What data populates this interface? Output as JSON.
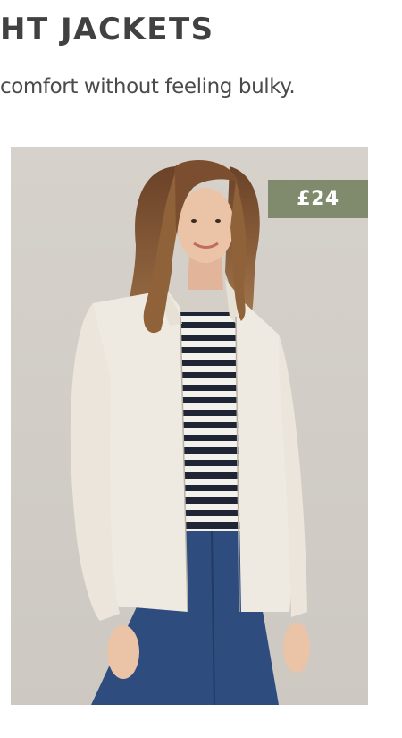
{
  "section": {
    "heading": "HT JACKETS",
    "subheading": "comfort without feeling bulky."
  },
  "product": {
    "price": "£24",
    "image_icon": "model-wearing-cream-fleece-jacket",
    "colors": {
      "background": "#d3cfc8",
      "jacket": "#efeae1",
      "price_badge": "#7f8b6c"
    }
  }
}
